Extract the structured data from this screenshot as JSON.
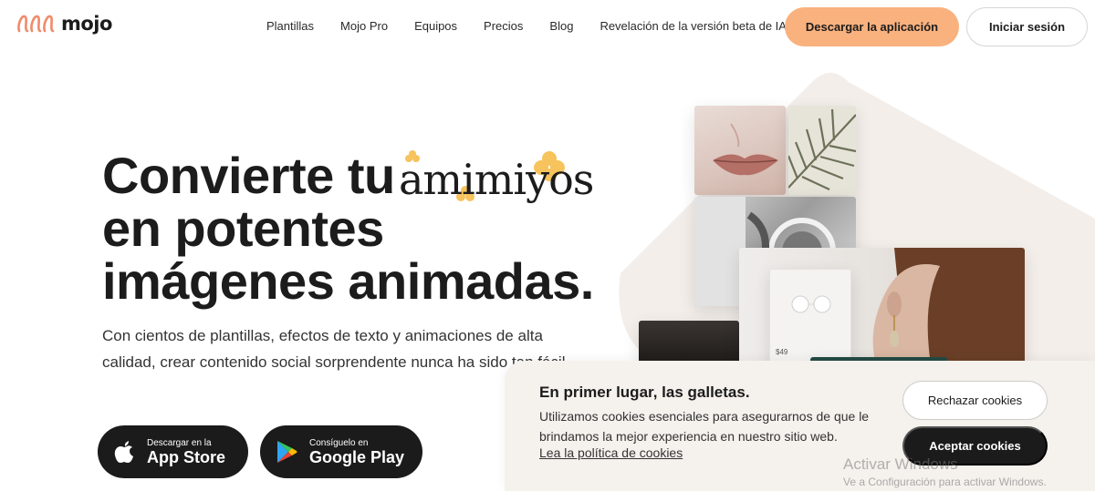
{
  "nav": {
    "logo_text": "mojo",
    "links": [
      "Plantillas",
      "Mojo Pro",
      "Equipos",
      "Precios",
      "Blog",
      "Revelación de la versión beta de IA"
    ],
    "download_label": "Descargar la aplicación",
    "login_label": "Iniciar sesión"
  },
  "hero": {
    "headline_line1": "Convierte tu",
    "headline_line2": "en potentes",
    "headline_line3": "imágenes animadas.",
    "handwritten_word": "amimiyos",
    "subtext": "Con cientos de plantillas, efectos de texto y animaciones de alta calidad, crear contenido social sorprendente nunca ha sido tan fácil.",
    "appstore_small": "Descargar en la",
    "appstore_big": "App Store",
    "googleplay_small": "Consíguelo en",
    "googleplay_big": "Google Play"
  },
  "collage": {
    "price_tag": "$49"
  },
  "cookie": {
    "title": "En primer lugar, las galletas.",
    "text": "Utilizamos cookies esenciales para asegurarnos de que le brindamos la mejor experiencia en nuestro sitio web.",
    "policy_link": "Lea la política de cookies",
    "reject_label": "Rechazar cookies",
    "accept_label": "Aceptar cookies"
  },
  "watermark": {
    "title": "Activar Windows",
    "subtitle": "Ve a Configuración para activar Windows."
  },
  "colors": {
    "accent": "#f9b17e",
    "logo": "#f08b6a",
    "dark": "#1b1b1b",
    "cookie_bg": "#f5f1ed",
    "flower": "#f6c35c"
  }
}
